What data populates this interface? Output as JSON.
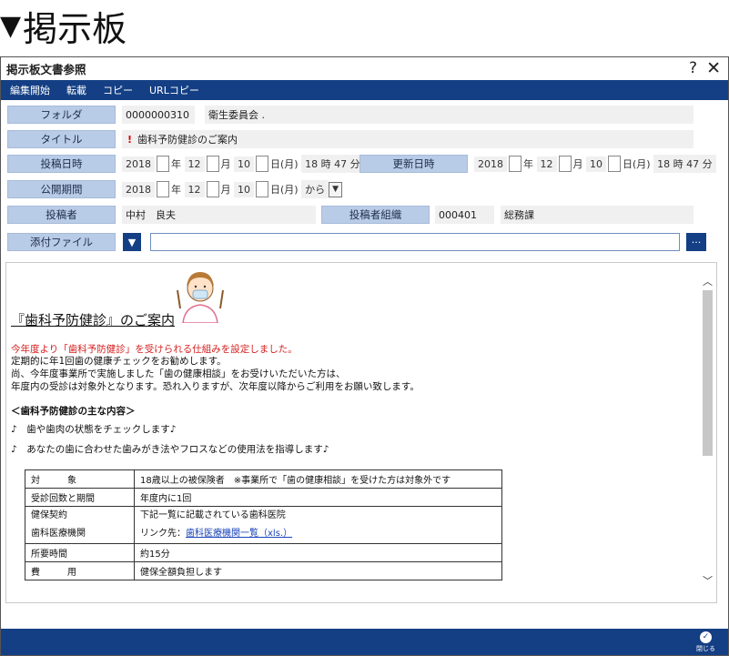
{
  "heading": {
    "marker": "▼",
    "text": "掲示板"
  },
  "window": {
    "title": "掲示板文書参照",
    "help": "?",
    "close": "✕"
  },
  "menu": [
    "編集開始",
    "転載",
    "コピー",
    "URLコピー"
  ],
  "form": {
    "folder_label": "フォルダ",
    "folder_id": "0000000310",
    "folder_name": "衛生委員会 .",
    "title_label": "タイトル",
    "warning_mark": "!",
    "title_value": "歯科予防健診のご案内",
    "post_date_label": "投稿日時",
    "post_date": {
      "year": "2018",
      "year_suffix": "年",
      "month": "12",
      "month_suffix": "月",
      "day": "10",
      "day_suffix": "日(月)",
      "hour": "18",
      "hour_suffix": "時",
      "minute": "47",
      "minute_suffix": "分"
    },
    "update_date_label": "更新日時",
    "update_date": {
      "year": "2018",
      "year_suffix": "年",
      "month": "12",
      "month_suffix": "月",
      "day": "10",
      "day_suffix": "日(月)",
      "hour": "18",
      "hour_suffix": "時",
      "minute": "47",
      "minute_suffix": "分"
    },
    "publish_label": "公開期間",
    "publish": {
      "year": "2018",
      "year_suffix": "年",
      "month": "12",
      "month_suffix": "月",
      "day": "10",
      "day_suffix": "日(月)",
      "from": "から"
    },
    "poster_label": "投稿者",
    "poster_name": "中村　良夫",
    "org_label": "投稿者組織",
    "org_code": "000401",
    "org_name": "総務課",
    "attach_label": "添付ファイル",
    "more_button": "···"
  },
  "content": {
    "doc_title": "『歯科予防健診』のご案内",
    "red_line": "今年度より「歯科予防健診」を受けられる仕組みを設定しました。",
    "lines": [
      "定期的に年1回歯の健康チェックをお勧めします。",
      "尚、今年度事業所で実施しました「歯の健康相談」をお受けいただいた方は、",
      "年度内の受診は対象外となります。恐れ入りますが、次年度以降からご利用をお願い致します。"
    ],
    "section_title": "＜歯科予防健診の主な内容＞",
    "bullets": [
      "♪　歯や歯肉の状態をチェックします♪",
      "♪　あなたの歯に合わせた歯みがき法やフロスなどの使用法を指導します♪"
    ],
    "table": {
      "row1": {
        "label": "対　　　象",
        "value": "18歳以上の被保険者　※事業所で「歯の健康相談」を受けた方は対象外です"
      },
      "row2": {
        "label": "受診回数と期間",
        "value": "年度内に1回"
      },
      "row3": {
        "label1": "健保契約",
        "label2": "歯科医療機関",
        "value1": "下記一覧に記載されている歯科医院",
        "link_prefix": "リンク先：",
        "link_text": "歯科医療機関一覧（xls.）"
      },
      "row4": {
        "label": "所要時間",
        "value": "約15分"
      },
      "row5": {
        "label": "費　　　用",
        "value": "健保全額負担します"
      }
    }
  },
  "footer": {
    "ok_icon": "✓",
    "ok_label": "閉じる"
  },
  "colors": {
    "menubar": "#143f84",
    "label_bg": "#b9cce7",
    "warning": "#d62020",
    "link": "#1a44b8"
  }
}
